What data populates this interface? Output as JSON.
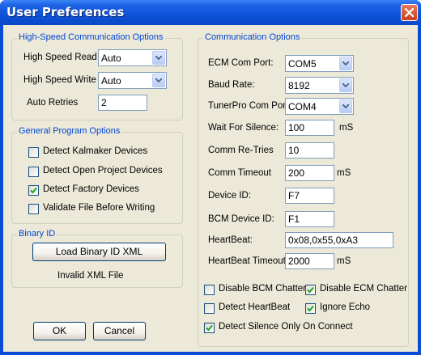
{
  "window": {
    "title": "User Preferences"
  },
  "high_speed": {
    "title": "High-Speed Communication Options",
    "read_label": "High Speed Read",
    "read_value": "Auto",
    "write_label": "High Speed Write",
    "write_value": "Auto",
    "retries_label": "Auto Retries",
    "retries_value": "2"
  },
  "general": {
    "title": "General Program Options",
    "options": [
      {
        "label": "Detect Kalmaker Devices",
        "checked": false
      },
      {
        "label": "Detect Open Project Devices",
        "checked": false
      },
      {
        "label": "Detect Factory Devices",
        "checked": true
      },
      {
        "label": "Validate File Before Writing",
        "checked": false
      }
    ]
  },
  "binary": {
    "title": "Binary ID",
    "load_button": "Load Binary ID XML",
    "status": "Invalid XML File"
  },
  "buttons": {
    "ok": "OK",
    "cancel": "Cancel"
  },
  "comm": {
    "title": "Communication Options",
    "ecm_port_label": "ECM Com Port:",
    "ecm_port_value": "COM5",
    "baud_label": "Baud Rate:",
    "baud_value": "8192",
    "tunerpro_label": "TunerPro Com Port:",
    "tunerpro_value": "COM4",
    "wait_label": "Wait For Silence:",
    "wait_value": "100",
    "wait_unit": "mS",
    "retries_label": "Comm Re-Tries",
    "retries_value": "10",
    "timeout_label": "Comm Timeout",
    "timeout_value": "200",
    "timeout_unit": "mS",
    "device_label": "Device ID:",
    "device_value": "F7",
    "bcm_label": "BCM Device ID:",
    "bcm_value": "F1",
    "heartbeat_label": "HeartBeat:",
    "heartbeat_value": "0x08,0x55,0xA3",
    "hb_timeout_label": "HeartBeat Timeout",
    "hb_timeout_value": "2000",
    "hb_timeout_unit": "mS",
    "checks": [
      {
        "label": "Disable BCM Chatter",
        "checked": false
      },
      {
        "label": "Disable ECM Chatter",
        "checked": true
      },
      {
        "label": "Detect HeartBeat",
        "checked": false
      },
      {
        "label": "Ignore Echo",
        "checked": true
      },
      {
        "label": "Detect Silence Only On Connect",
        "checked": true
      }
    ]
  }
}
